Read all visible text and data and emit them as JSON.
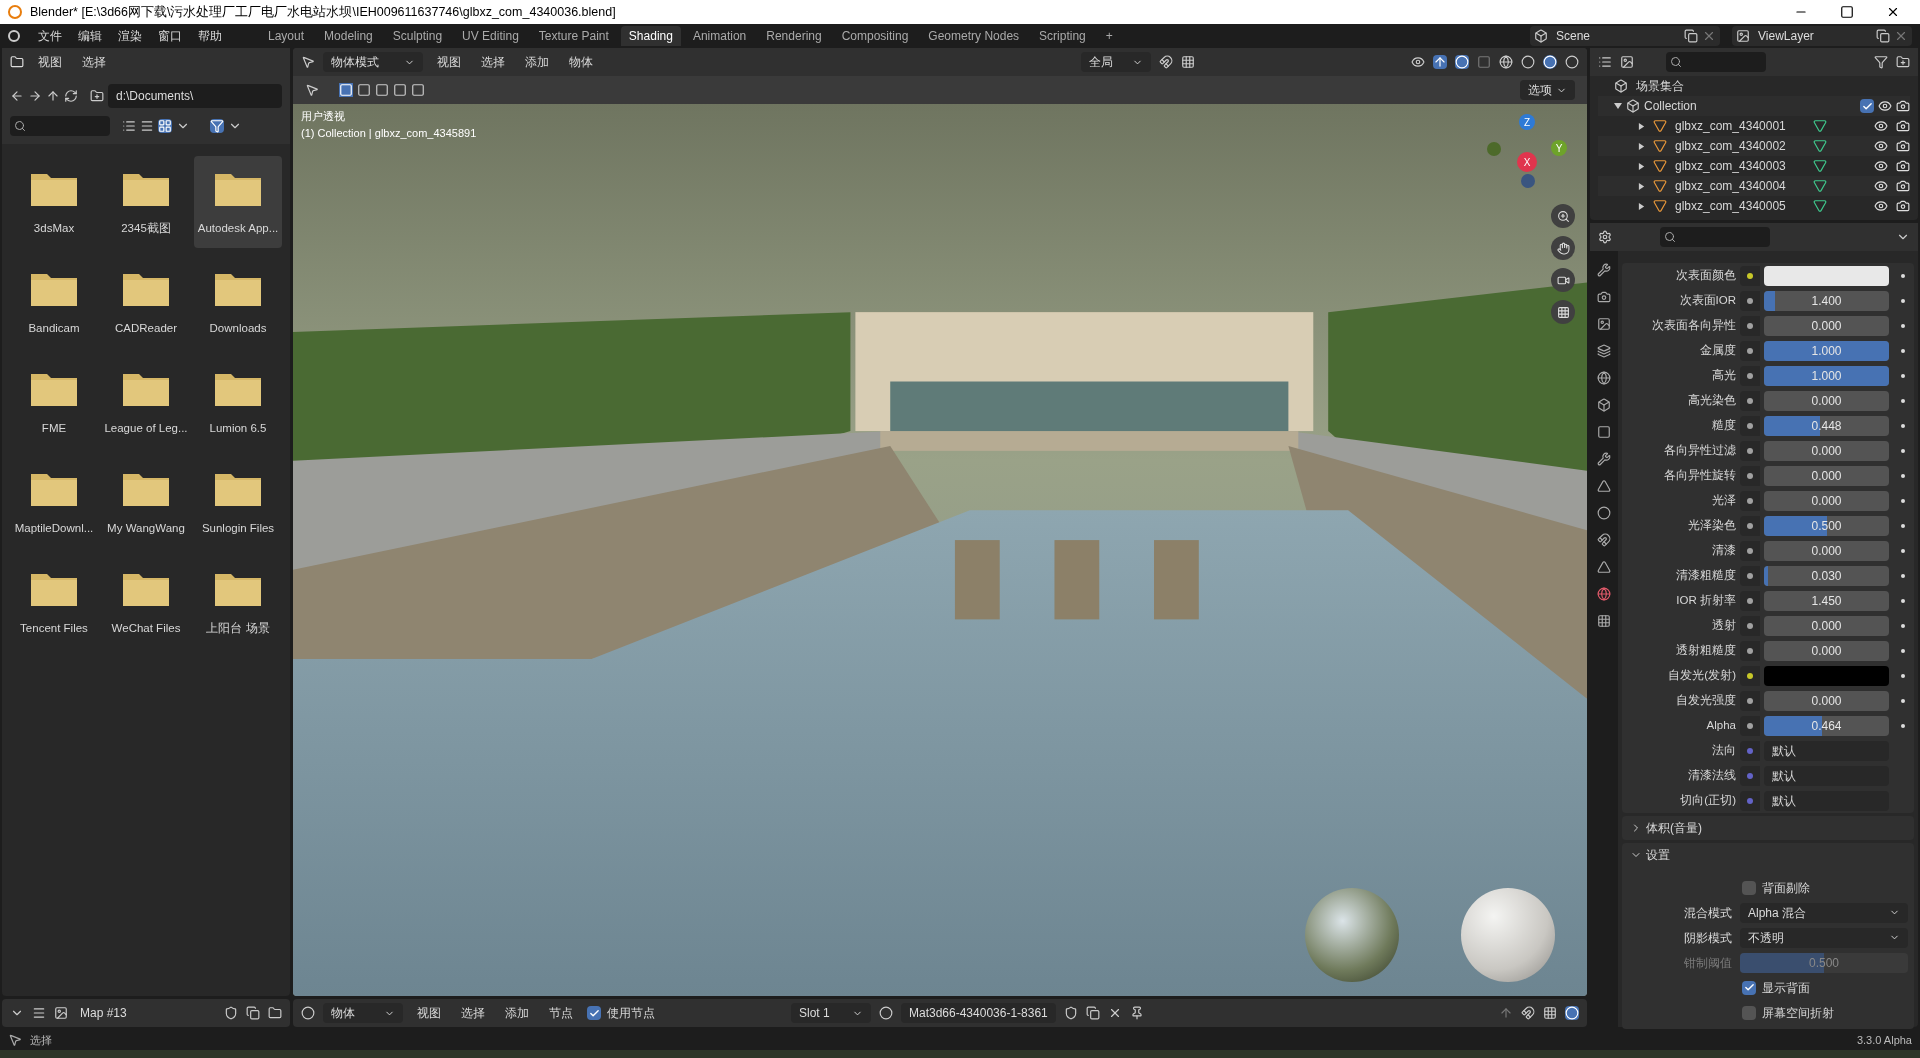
{
  "window": {
    "title": "Blender* [E:\\3d66网下载\\污水处理厂工厂电厂水电站水坝\\IEH009611637746\\glbxz_com_4340036.blend]"
  },
  "menu": [
    "文件",
    "编辑",
    "渲染",
    "窗口",
    "帮助"
  ],
  "workspaces": [
    {
      "label": "Layout",
      "selected": false
    },
    {
      "label": "Modeling",
      "selected": false
    },
    {
      "label": "Sculpting",
      "selected": false
    },
    {
      "label": "UV Editing",
      "selected": false
    },
    {
      "label": "Texture Paint",
      "selected": false
    },
    {
      "label": "Shading",
      "selected": true
    },
    {
      "label": "Animation",
      "selected": false
    },
    {
      "label": "Rendering",
      "selected": false
    },
    {
      "label": "Compositing",
      "selected": false
    },
    {
      "label": "Geometry Nodes",
      "selected": false
    },
    {
      "label": "Scripting",
      "selected": false
    },
    {
      "label": "+",
      "selected": false
    }
  ],
  "scene": "Scene",
  "view_layer": "ViewLayer",
  "file_browser": {
    "menus": [
      "视图",
      "选择"
    ],
    "path": "d:\\Documents\\",
    "folders": [
      {
        "name": "3dsMax",
        "selected": false
      },
      {
        "name": "2345截图",
        "selected": false
      },
      {
        "name": "Autodesk App...",
        "selected": true
      },
      {
        "name": "Bandicam",
        "selected": false
      },
      {
        "name": "CADReader",
        "selected": false
      },
      {
        "name": "Downloads",
        "selected": false
      },
      {
        "name": "FME",
        "selected": false
      },
      {
        "name": "League of Leg...",
        "selected": false
      },
      {
        "name": "Lumion 6.5",
        "selected": false
      },
      {
        "name": "MaptileDownl...",
        "selected": false
      },
      {
        "name": "My WangWang",
        "selected": false
      },
      {
        "name": "Sunlogin Files",
        "selected": false
      },
      {
        "name": "Tencent Files",
        "selected": false
      },
      {
        "name": "WeChat Files",
        "selected": false
      },
      {
        "name": "上阳台 场景",
        "selected": false
      }
    ]
  },
  "viewport": {
    "mode": "物体模式",
    "menus": [
      "视图",
      "选择",
      "添加",
      "物体"
    ],
    "orientation": "全局",
    "options": "选项",
    "view_name": "用户透视",
    "collection_info": "(1) Collection | glbxz_com_4345891",
    "axes": {
      "z": "Z",
      "x": "X",
      "y": "Y"
    }
  },
  "outliner": {
    "root": "场景集合",
    "collection": {
      "name": "Collection",
      "checked": true,
      "expanded": true,
      "children": [
        {
          "name": "glbxz_com_4340001",
          "expanded": false
        },
        {
          "name": "glbxz_com_4340002",
          "expanded": false
        },
        {
          "name": "glbxz_com_4340003",
          "expanded": false
        },
        {
          "name": "glbxz_com_4340004",
          "expanded": false
        },
        {
          "name": "glbxz_com_4340005",
          "expanded": false
        }
      ]
    }
  },
  "properties": {
    "rows": [
      {
        "kind": "color",
        "label": "次表面颜色",
        "color": "#e8e8e8"
      },
      {
        "kind": "slider",
        "label": "次表面IOR",
        "value": "1.400",
        "level": 0.09
      },
      {
        "kind": "slider",
        "label": "次表面各向异性",
        "value": "0.000",
        "level": 0
      },
      {
        "kind": "slider",
        "label": "金属度",
        "value": "1.000",
        "level": 1
      },
      {
        "kind": "slider",
        "label": "高光",
        "value": "1.000",
        "level": 1
      },
      {
        "kind": "slider",
        "label": "高光染色",
        "value": "0.000",
        "level": 0
      },
      {
        "kind": "slider",
        "label": "糙度",
        "value": "0.448",
        "level": 0.448
      },
      {
        "kind": "slider",
        "label": "各向异性过滤",
        "value": "0.000",
        "level": 0
      },
      {
        "kind": "slider",
        "label": "各向异性旋转",
        "value": "0.000",
        "level": 0
      },
      {
        "kind": "slider",
        "label": "光泽",
        "value": "0.000",
        "level": 0
      },
      {
        "kind": "slider",
        "label": "光泽染色",
        "value": "0.500",
        "level": 0.5
      },
      {
        "kind": "slider",
        "label": "清漆",
        "value": "0.000",
        "level": 0
      },
      {
        "kind": "slider",
        "label": "清漆粗糙度",
        "value": "0.030",
        "level": 0.03
      },
      {
        "kind": "slider",
        "label": "IOR 折射率",
        "value": "1.450",
        "level": 0
      },
      {
        "kind": "slider",
        "label": "透射",
        "value": "0.000",
        "level": 0
      },
      {
        "kind": "slider",
        "label": "透射粗糙度",
        "value": "0.000",
        "level": 0
      },
      {
        "kind": "color",
        "label": "自发光(发射)",
        "color": "#000000"
      },
      {
        "kind": "slider",
        "label": "自发光强度",
        "value": "0.000",
        "level": 0
      },
      {
        "kind": "slider",
        "label": "Alpha",
        "value": "0.464",
        "level": 0.464
      },
      {
        "kind": "vector",
        "label": "法向",
        "value": "默认"
      },
      {
        "kind": "vector",
        "label": "清漆法线",
        "value": "默认"
      },
      {
        "kind": "vector",
        "label": "切向(正切)",
        "value": "默认"
      }
    ],
    "panels": [
      {
        "title": "体积(音量)",
        "expanded": false
      },
      {
        "title": "设置",
        "expanded": true,
        "settings": [
          {
            "kind": "checkbox",
            "label": "背面剔除",
            "checked": false
          },
          {
            "kind": "dropdown",
            "label": "混合模式",
            "value": "Alpha 混合"
          },
          {
            "kind": "dropdown",
            "label": "阴影模式",
            "value": "不透明"
          },
          {
            "kind": "slider",
            "label": "钳制阈值",
            "value": "0.500",
            "level": 0.5,
            "disabled": true
          },
          {
            "kind": "checkbox",
            "label": "显示背面",
            "checked": true
          },
          {
            "kind": "checkbox",
            "label": "屏幕空间折射",
            "checked": false
          }
        ]
      }
    ]
  },
  "image_editor": {
    "image": "Map #13"
  },
  "node_editor": {
    "mode": "物体",
    "menus": [
      "视图",
      "选择",
      "添加",
      "节点"
    ],
    "use_nodes": {
      "label": "使用节点",
      "checked": true
    },
    "slot": "Slot 1",
    "material": "Mat3d66-4340036-1-8361"
  },
  "status_bar": {
    "hint": "选择",
    "version": "3.3.0 Alpha"
  }
}
